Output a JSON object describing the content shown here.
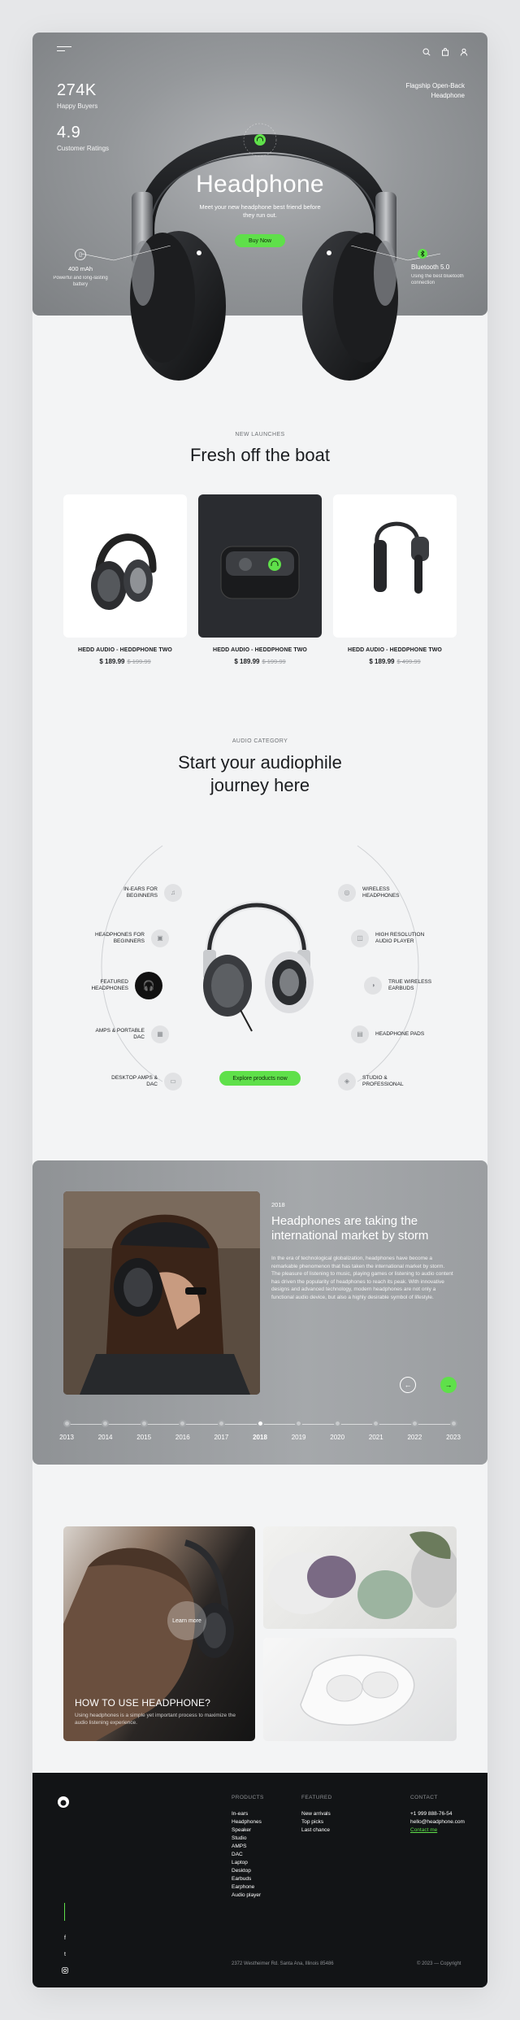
{
  "hero": {
    "stats": [
      {
        "value": "274K",
        "label": "Happy Buyers"
      },
      {
        "value": "4.9",
        "label": "Customer Ratings"
      }
    ],
    "flagship": "Flagship Open-Back Headphone",
    "title": "Headphone",
    "subtitle": "Meet your new headphone best friend before they run out.",
    "cta": "Buy Now",
    "feature_left": {
      "title": "400 mAh",
      "desc": "Powerful and long-lasting battery"
    },
    "feature_right": {
      "title": "Bluetooth 5.0",
      "desc": "Using the best bluetooth connection"
    }
  },
  "launches": {
    "eyebrow": "NEW LAUNCHES",
    "title": "Fresh off the boat",
    "products": [
      {
        "name": "HEDD AUDIO - HEDDPHONE TWO",
        "price": "$ 189.99",
        "old_price": "$ 199.99"
      },
      {
        "name": "HEDD AUDIO - HEDDPHONE TWO",
        "price": "$ 189.99",
        "old_price": "$ 199.99"
      },
      {
        "name": "HEDD AUDIO - HEDDPHONE TWO",
        "price": "$ 189.99",
        "old_price": "$ 499.99"
      }
    ]
  },
  "category": {
    "eyebrow": "AUDIO CATEGORY",
    "title_line1": "Start your audiophile",
    "title_line2": "journey here",
    "left_items": [
      "IN-EARS FOR BEGINNERS",
      "HEADPHONES FOR BEGINNERS",
      "FEATURED HEADPHONES",
      "AMPS & PORTABLE DAC",
      "DESKTOP AMPS & DAC"
    ],
    "right_items": [
      "WIRELESS HEADPHONES",
      "HIGH RESOLUTION AUDIO PLAYER",
      "TRUE WIRELESS EARBUDS",
      "HEADPHONE PADS",
      "STUDIO & PROFESSIONAL"
    ],
    "cta": "Explore products now"
  },
  "story": {
    "year": "2018",
    "title": "Headphones are taking the international market by storm",
    "text": "In the era of technological globalization, headphones have become a remarkable phenomenon that has taken the international market by storm. The pleasure of listening to music, playing games or listening to audio content has driven the popularity of headphones to reach its peak. With innovative designs and advanced technology, modern headphones are not only a functional audio device, but also a highly desirable symbol of lifestyle.",
    "timeline": [
      "2013",
      "2014",
      "2015",
      "2016",
      "2017",
      "2018",
      "2019",
      "2020",
      "2021",
      "2022",
      "2023"
    ],
    "active_year": "2018"
  },
  "howto": {
    "learn": "Learn more",
    "title": "HOW TO USE HEADPHONE?",
    "text": "Using headphones is a simple yet important process to maximize the audio listening experience."
  },
  "footer": {
    "products_heading": "PRODUCTS",
    "products": [
      "In-ears",
      "Headphones",
      "Speaker",
      "Studio",
      "AMPS",
      "DAC",
      "Laptop",
      "Desktop",
      "Earbuds",
      "Earphone",
      "Audio player"
    ],
    "featured_heading": "FEATURED",
    "featured": [
      "New arrivals",
      "Top picks",
      "Last chance"
    ],
    "contact_heading": "CONTACT",
    "phone": "+1 999 888-76-54",
    "email": "hello@headphone.com",
    "contact_link": "Contact me",
    "address": "2372 Westheimer Rd. Santa Ana, Illinois 85486",
    "copyright": "© 2023 — Copyright"
  },
  "colors": {
    "accent": "#5fe04a",
    "dark": "#121416",
    "hero_grey": "#95989b"
  }
}
